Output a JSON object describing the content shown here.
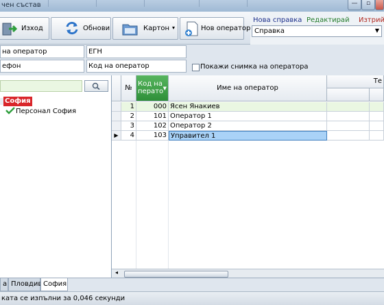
{
  "window": {
    "title": "чен състав"
  },
  "toolbar": {
    "exit_label": "Изход",
    "refresh_label": "Обнови",
    "card_label": "Картон",
    "new_operator_label": "Нов оператор"
  },
  "links": {
    "new_ref": "Нова справка",
    "edit": "Редактирай",
    "delete": "Изтрий"
  },
  "report_combo": {
    "value": "Справка"
  },
  "filters": {
    "operator_name": "на оператор",
    "egn": "ЕГН",
    "phone": "ефон",
    "operator_code": "Код на оператор",
    "show_photo_label": "Покажи снимка на оператора"
  },
  "tree": {
    "root": "София",
    "child": "Персонал София"
  },
  "grid": {
    "headers": {
      "num": "№",
      "code": "Код на перато",
      "name": "Име на оператор",
      "extra": "Те"
    },
    "rows": [
      {
        "num": "1",
        "code": "000",
        "name": "Ясен Янакиев"
      },
      {
        "num": "2",
        "code": "101",
        "name": "Оператор 1"
      },
      {
        "num": "3",
        "code": "102",
        "name": "Оператор 2"
      },
      {
        "num": "4",
        "code": "103",
        "name": "Управител 1"
      }
    ]
  },
  "tabs": [
    "а",
    "Пловдив",
    "София"
  ],
  "status": {
    "text": "ката се изпълни за 0,046 секунди"
  },
  "colors": {
    "accent_green": "#2e9e3c",
    "root_red": "#d9262b",
    "selected_blue": "#a9d2f7"
  }
}
